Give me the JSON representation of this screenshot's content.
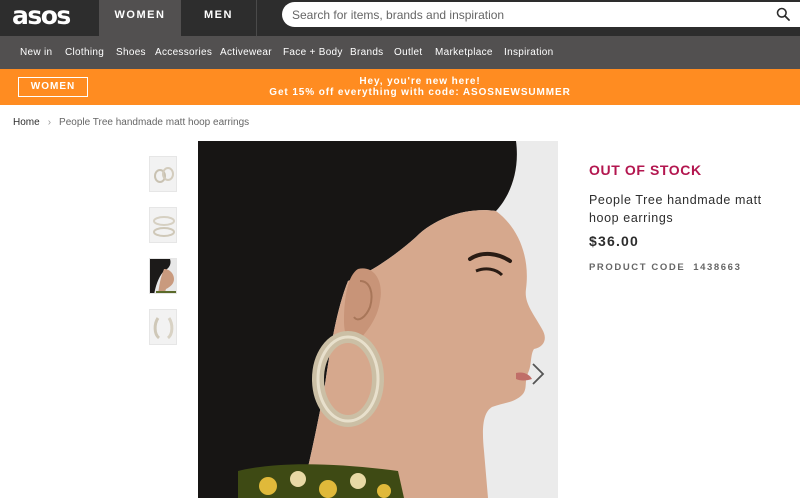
{
  "header": {
    "logo": "asos",
    "tabs": [
      "WOMEN",
      "MEN"
    ],
    "search_placeholder": "Search for items, brands and inspiration",
    "search_icon": "search-icon"
  },
  "nav": {
    "items": [
      "New in",
      "Clothing",
      "Shoes",
      "Accessories",
      "Activewear",
      "Face + Body",
      "Brands",
      "Outlet",
      "Marketplace",
      "Inspiration"
    ]
  },
  "promo": {
    "button_label": "WOMEN",
    "line1": "Hey, you're new here!",
    "line2": "Get 15% off everything with code: ASOSNEWSUMMER"
  },
  "breadcrumb": {
    "home": "Home",
    "separator": "›",
    "current": "People Tree handmade matt hoop earrings"
  },
  "gallery": {
    "thumbnail_count": 4,
    "next_icon": "chevron-right-icon"
  },
  "product": {
    "stock_status": "OUT OF STOCK",
    "name": "People Tree handmade matt hoop earrings",
    "price": "$36.00",
    "code_label": "PRODUCT CODE",
    "code_value": "1438663"
  },
  "colors": {
    "header_bg": "#2d2d2d",
    "nav_bg": "#525050",
    "promo_bg": "#ff8c21",
    "out_of_stock": "#b3164f"
  }
}
